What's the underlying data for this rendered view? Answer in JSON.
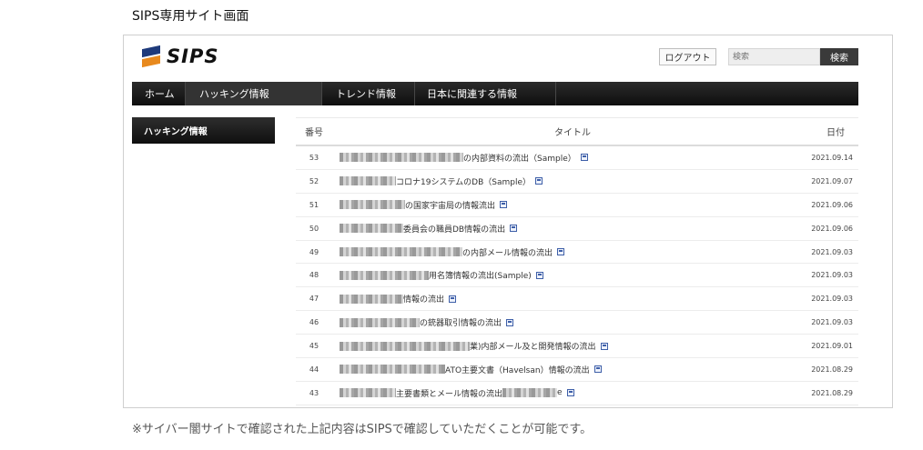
{
  "caption": "SIPS専用サイト画面",
  "brand": {
    "name": "SIPS",
    "colors": {
      "navy": "#1e3a7b",
      "orange": "#e8891d"
    }
  },
  "header": {
    "logout_label": "ログアウト",
    "search_placeholder": "検索",
    "search_button": "検索"
  },
  "nav": {
    "items": [
      {
        "label": "ホーム",
        "active": false
      },
      {
        "label": "ハッキング情報",
        "active": true
      },
      {
        "label": "トレンド情報",
        "active": false
      },
      {
        "label": "日本に関連する情報",
        "active": false
      }
    ]
  },
  "sidebar": {
    "title": "ハッキング情報"
  },
  "table": {
    "headers": {
      "number": "番号",
      "title": "タイトル",
      "date": "日付"
    },
    "rows": [
      {
        "number": "53",
        "title": "の内部資料の流出（Sample）",
        "date": "2021.09.14"
      },
      {
        "number": "52",
        "title": "コロナ19システムのDB（Sample）",
        "date": "2021.09.07"
      },
      {
        "number": "51",
        "title": "の国家宇宙局の情報流出",
        "date": "2021.09.06"
      },
      {
        "number": "50",
        "title": "委員会の職員DB情報の流出",
        "date": "2021.09.06"
      },
      {
        "number": "49",
        "title": "の内部メール情報の流出",
        "date": "2021.09.03"
      },
      {
        "number": "48",
        "title": "用名簿情報の流出(Sample)",
        "date": "2021.09.03"
      },
      {
        "number": "47",
        "title": "情報の流出",
        "date": "2021.09.03"
      },
      {
        "number": "46",
        "title": "の銃器取引情報の流出",
        "date": "2021.09.03"
      },
      {
        "number": "45",
        "title": "業)内部メール及と開発情報の流出",
        "date": "2021.09.01"
      },
      {
        "number": "44",
        "title": "ATO主要文書（Havelsan）情報の流出",
        "date": "2021.08.29"
      },
      {
        "number": "43",
        "title": "主要書類とメール情報の流出",
        "title_tail": "e",
        "date": "2021.08.29"
      }
    ]
  },
  "footnote": "※サイバー闇サイトで確認された上記内容はSIPSで確認していただくことが可能です。"
}
